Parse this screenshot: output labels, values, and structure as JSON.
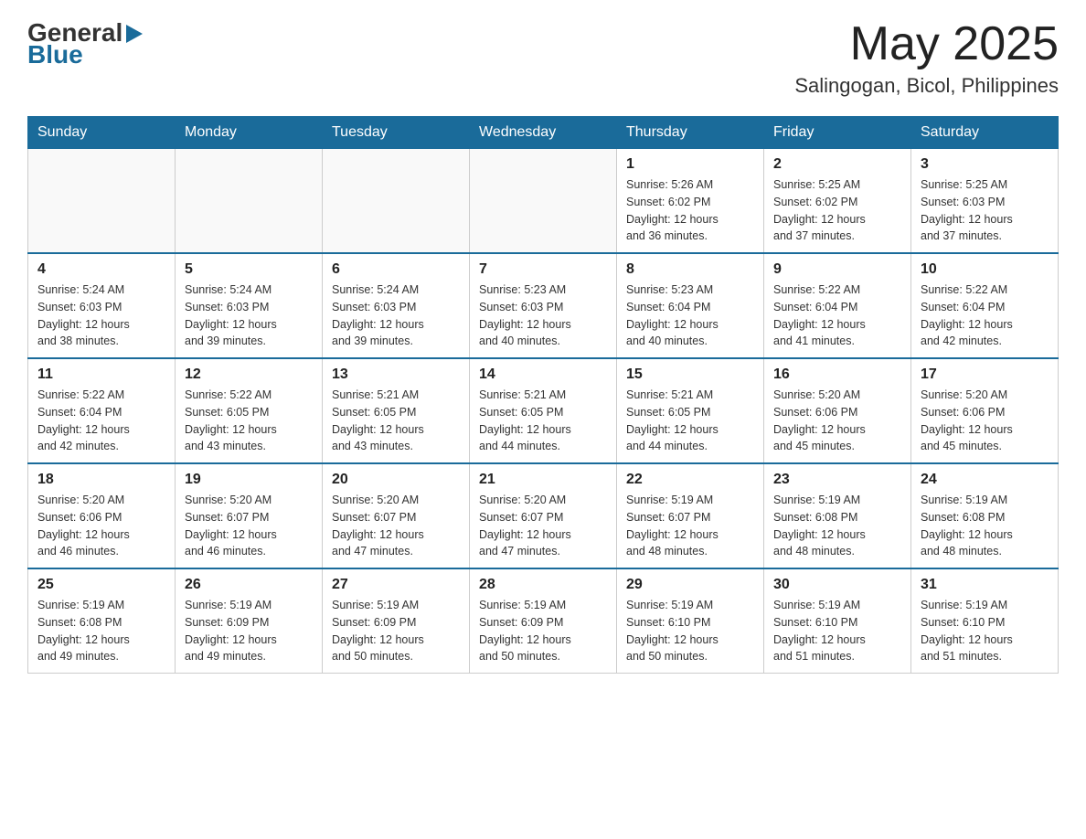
{
  "header": {
    "logo_general": "General",
    "logo_blue": "Blue",
    "month_title": "May 2025",
    "location": "Salingogan, Bicol, Philippines"
  },
  "weekdays": [
    "Sunday",
    "Monday",
    "Tuesday",
    "Wednesday",
    "Thursday",
    "Friday",
    "Saturday"
  ],
  "weeks": [
    [
      {
        "day": "",
        "info": ""
      },
      {
        "day": "",
        "info": ""
      },
      {
        "day": "",
        "info": ""
      },
      {
        "day": "",
        "info": ""
      },
      {
        "day": "1",
        "info": "Sunrise: 5:26 AM\nSunset: 6:02 PM\nDaylight: 12 hours\nand 36 minutes."
      },
      {
        "day": "2",
        "info": "Sunrise: 5:25 AM\nSunset: 6:02 PM\nDaylight: 12 hours\nand 37 minutes."
      },
      {
        "day": "3",
        "info": "Sunrise: 5:25 AM\nSunset: 6:03 PM\nDaylight: 12 hours\nand 37 minutes."
      }
    ],
    [
      {
        "day": "4",
        "info": "Sunrise: 5:24 AM\nSunset: 6:03 PM\nDaylight: 12 hours\nand 38 minutes."
      },
      {
        "day": "5",
        "info": "Sunrise: 5:24 AM\nSunset: 6:03 PM\nDaylight: 12 hours\nand 39 minutes."
      },
      {
        "day": "6",
        "info": "Sunrise: 5:24 AM\nSunset: 6:03 PM\nDaylight: 12 hours\nand 39 minutes."
      },
      {
        "day": "7",
        "info": "Sunrise: 5:23 AM\nSunset: 6:03 PM\nDaylight: 12 hours\nand 40 minutes."
      },
      {
        "day": "8",
        "info": "Sunrise: 5:23 AM\nSunset: 6:04 PM\nDaylight: 12 hours\nand 40 minutes."
      },
      {
        "day": "9",
        "info": "Sunrise: 5:22 AM\nSunset: 6:04 PM\nDaylight: 12 hours\nand 41 minutes."
      },
      {
        "day": "10",
        "info": "Sunrise: 5:22 AM\nSunset: 6:04 PM\nDaylight: 12 hours\nand 42 minutes."
      }
    ],
    [
      {
        "day": "11",
        "info": "Sunrise: 5:22 AM\nSunset: 6:04 PM\nDaylight: 12 hours\nand 42 minutes."
      },
      {
        "day": "12",
        "info": "Sunrise: 5:22 AM\nSunset: 6:05 PM\nDaylight: 12 hours\nand 43 minutes."
      },
      {
        "day": "13",
        "info": "Sunrise: 5:21 AM\nSunset: 6:05 PM\nDaylight: 12 hours\nand 43 minutes."
      },
      {
        "day": "14",
        "info": "Sunrise: 5:21 AM\nSunset: 6:05 PM\nDaylight: 12 hours\nand 44 minutes."
      },
      {
        "day": "15",
        "info": "Sunrise: 5:21 AM\nSunset: 6:05 PM\nDaylight: 12 hours\nand 44 minutes."
      },
      {
        "day": "16",
        "info": "Sunrise: 5:20 AM\nSunset: 6:06 PM\nDaylight: 12 hours\nand 45 minutes."
      },
      {
        "day": "17",
        "info": "Sunrise: 5:20 AM\nSunset: 6:06 PM\nDaylight: 12 hours\nand 45 minutes."
      }
    ],
    [
      {
        "day": "18",
        "info": "Sunrise: 5:20 AM\nSunset: 6:06 PM\nDaylight: 12 hours\nand 46 minutes."
      },
      {
        "day": "19",
        "info": "Sunrise: 5:20 AM\nSunset: 6:07 PM\nDaylight: 12 hours\nand 46 minutes."
      },
      {
        "day": "20",
        "info": "Sunrise: 5:20 AM\nSunset: 6:07 PM\nDaylight: 12 hours\nand 47 minutes."
      },
      {
        "day": "21",
        "info": "Sunrise: 5:20 AM\nSunset: 6:07 PM\nDaylight: 12 hours\nand 47 minutes."
      },
      {
        "day": "22",
        "info": "Sunrise: 5:19 AM\nSunset: 6:07 PM\nDaylight: 12 hours\nand 48 minutes."
      },
      {
        "day": "23",
        "info": "Sunrise: 5:19 AM\nSunset: 6:08 PM\nDaylight: 12 hours\nand 48 minutes."
      },
      {
        "day": "24",
        "info": "Sunrise: 5:19 AM\nSunset: 6:08 PM\nDaylight: 12 hours\nand 48 minutes."
      }
    ],
    [
      {
        "day": "25",
        "info": "Sunrise: 5:19 AM\nSunset: 6:08 PM\nDaylight: 12 hours\nand 49 minutes."
      },
      {
        "day": "26",
        "info": "Sunrise: 5:19 AM\nSunset: 6:09 PM\nDaylight: 12 hours\nand 49 minutes."
      },
      {
        "day": "27",
        "info": "Sunrise: 5:19 AM\nSunset: 6:09 PM\nDaylight: 12 hours\nand 50 minutes."
      },
      {
        "day": "28",
        "info": "Sunrise: 5:19 AM\nSunset: 6:09 PM\nDaylight: 12 hours\nand 50 minutes."
      },
      {
        "day": "29",
        "info": "Sunrise: 5:19 AM\nSunset: 6:10 PM\nDaylight: 12 hours\nand 50 minutes."
      },
      {
        "day": "30",
        "info": "Sunrise: 5:19 AM\nSunset: 6:10 PM\nDaylight: 12 hours\nand 51 minutes."
      },
      {
        "day": "31",
        "info": "Sunrise: 5:19 AM\nSunset: 6:10 PM\nDaylight: 12 hours\nand 51 minutes."
      }
    ]
  ]
}
